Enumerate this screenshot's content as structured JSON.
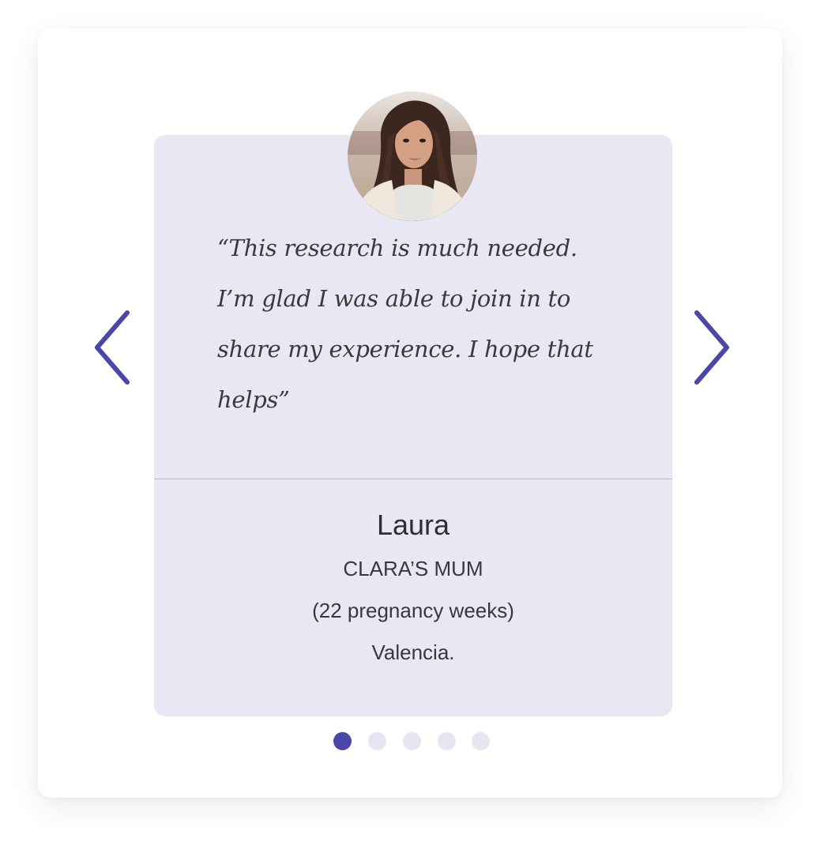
{
  "testimonial": {
    "quote": "“This research is much needed. I’m glad I was able to join in to share my experience. I hope that helps”",
    "name": "Laura",
    "relation": "CLARA’S MUM",
    "detail": "(22 pregnancy weeks)",
    "location": "Valencia."
  },
  "carousel": {
    "prev_icon": "chevron-left-icon",
    "next_icon": "chevron-right-icon",
    "dot_count": 5,
    "active_index": 0
  },
  "colors": {
    "accent": "#4b47a8",
    "panel": "#e8e7f3",
    "dot_inactive": "#e6e5f2",
    "text": "#2f2f33"
  }
}
